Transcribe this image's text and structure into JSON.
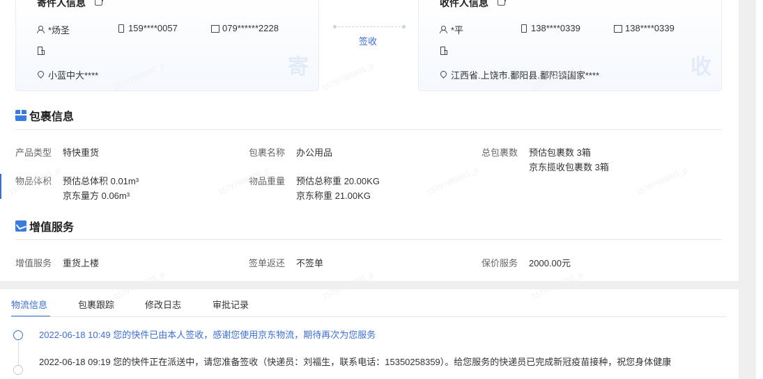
{
  "sender": {
    "title": "寄件人信息",
    "name": "*炀圣",
    "mobile": "159****0057",
    "phone": "079******2228",
    "company": "",
    "address": "小蓝中大****",
    "badge": "寄"
  },
  "receiver": {
    "title": "收件人信息",
    "name": "*平",
    "mobile": "138****0339",
    "phone": "138****0339",
    "company": "",
    "address": "江西省.上饶市.鄱阳县.鄱阳镇国家****",
    "badge": "收"
  },
  "status_link": "签收",
  "package_section": {
    "title": "包裹信息",
    "product_type_label": "产品类型",
    "product_type_value": "特快重货",
    "package_name_label": "包裹名称",
    "package_name_value": "办公用品",
    "total_packages_label": "总包裹数",
    "total_packages_estimated": "预估包裹数 3箱",
    "total_packages_collected": "京东揽收包裹数 3箱",
    "volume_label": "物品体积",
    "volume_estimated": "预估总体积 0.01m³",
    "volume_jd": "京东量方 0.06m³",
    "weight_label": "物品重量",
    "weight_estimated": "预估总称重 20.00KG",
    "weight_jd": "京东称重 21.00KG"
  },
  "service_section": {
    "title": "增值服务",
    "value_added_label": "增值服务",
    "value_added_value": "重货上楼",
    "sign_return_label": "签单返还",
    "sign_return_value": "不签单",
    "insurance_label": "保价服务",
    "insurance_value": "2000.00元"
  },
  "tabs": [
    "物流信息",
    "包裹跟踪",
    "修改日志",
    "审批记录"
  ],
  "active_tab": "物流信息",
  "timeline": [
    {
      "text": "2022-06-18 10:49 您的快件已由本人签收，感谢您使用京东物流，期待再次为您服务",
      "active": true
    },
    {
      "text": "2022-06-18 09:19 您的快件正在派送中，请您准备签收（快递员：刘福生，联系电话：15350258359）。给您服务的快递员已完成新冠疫苗接种，祝您身体健康",
      "active": false
    }
  ],
  "watermark": "15797985601_p",
  "colors": {
    "accent": "#3b6fd4",
    "label": "#666666",
    "text": "#333333"
  }
}
